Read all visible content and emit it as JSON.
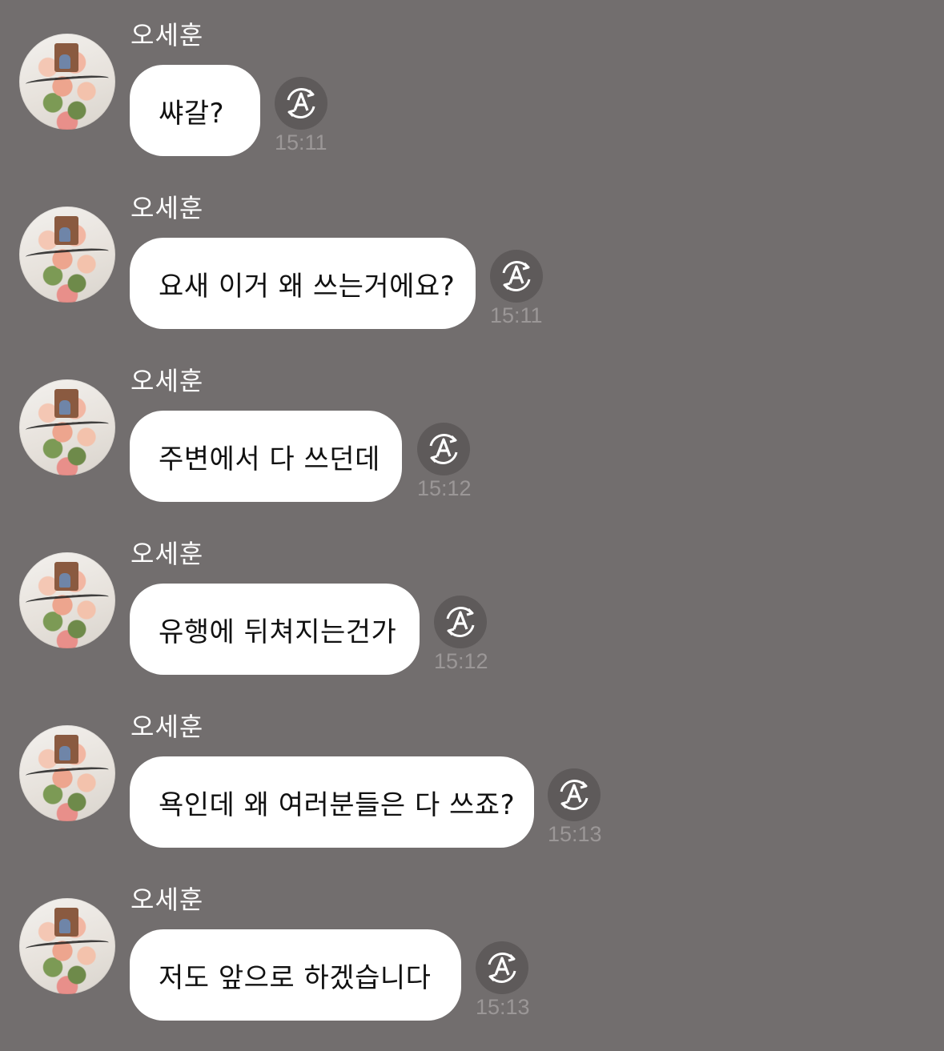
{
  "colors": {
    "background": "#726e6e",
    "bubble": "#ffffff",
    "bubble_text": "#111111",
    "sender_text": "#ffffff",
    "timestamp_text": "#9b9797",
    "translate_button": "#5e5a5a"
  },
  "icons": {
    "translate": "translate-icon",
    "avatar": "avatar-flower-bouquet"
  },
  "messages": [
    {
      "sender": "오세훈",
      "text": "쌰갈?",
      "time": "15:11"
    },
    {
      "sender": "오세훈",
      "text": "요새 이거 왜 쓰는거에요?",
      "time": "15:11"
    },
    {
      "sender": "오세훈",
      "text": "주변에서 다 쓰던데",
      "time": "15:12"
    },
    {
      "sender": "오세훈",
      "text": "유행에 뒤쳐지는건가",
      "time": "15:12"
    },
    {
      "sender": "오세훈",
      "text": "욕인데 왜 여러분들은 다 쓰죠?",
      "time": "15:13"
    },
    {
      "sender": "오세훈",
      "text": "저도 앞으로 하겠습니다",
      "time": "15:13"
    }
  ]
}
